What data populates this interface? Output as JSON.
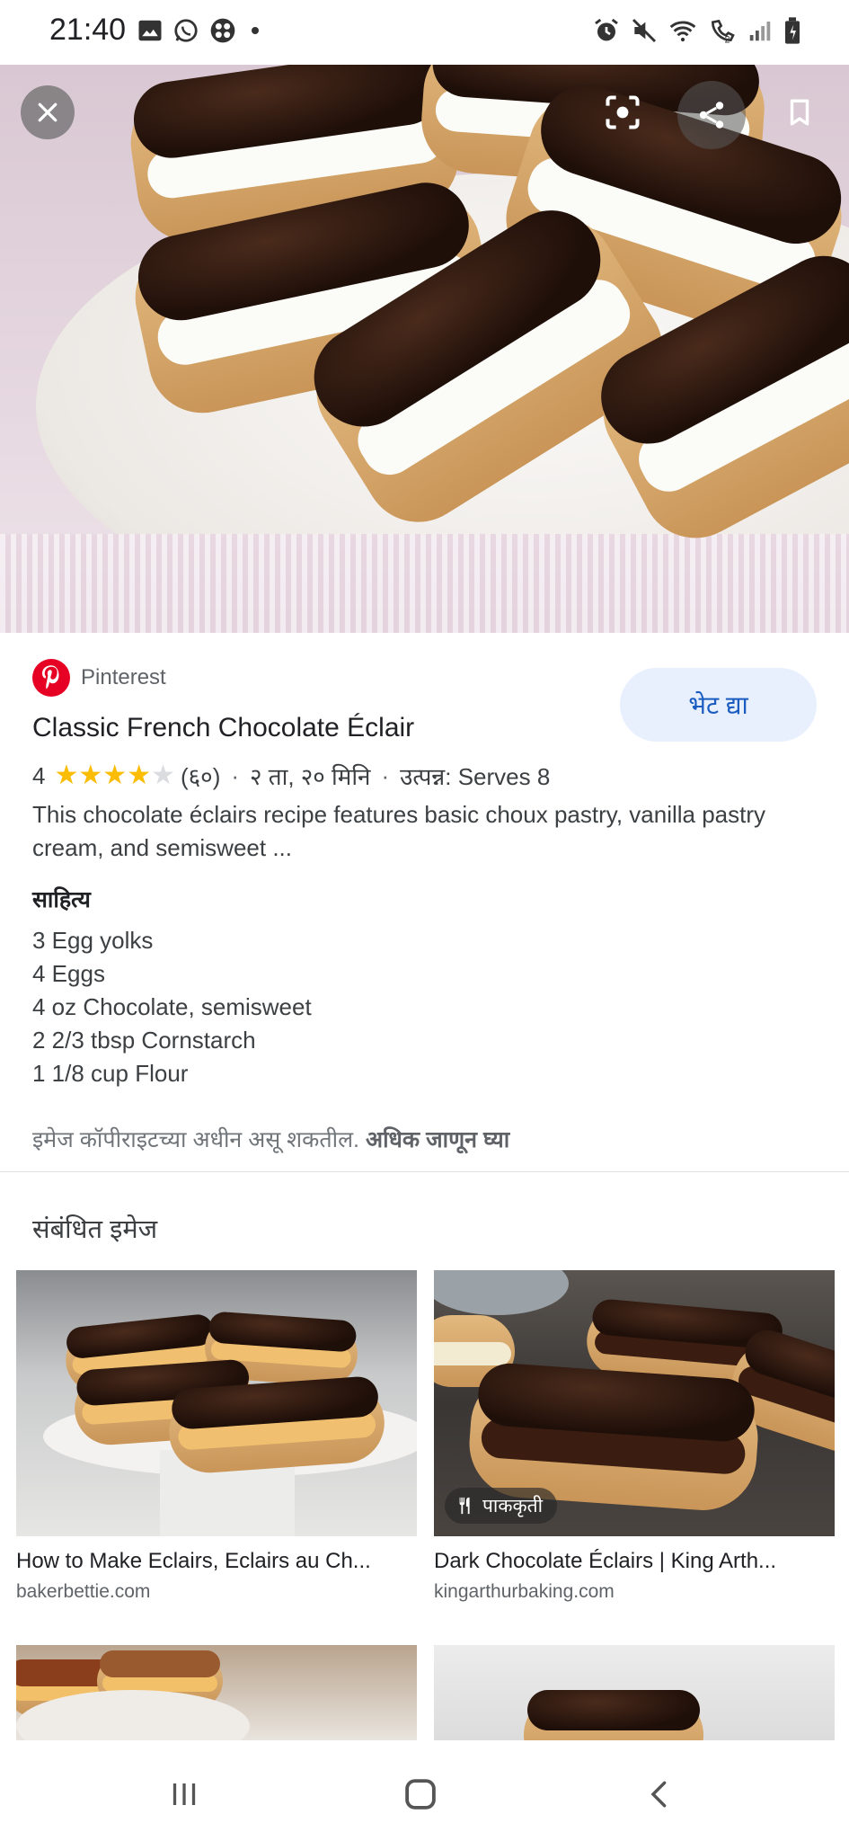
{
  "status_bar": {
    "time": "21:40"
  },
  "hero": {
    "colors": {
      "chocolate": "#2a150c",
      "pastry": "#d9a868",
      "cream": "#fbfbf7"
    }
  },
  "source": {
    "name": "Pinterest",
    "brand_color": "#e60023"
  },
  "visit_button": {
    "label": "भेट द्या"
  },
  "recipe": {
    "title": "Classic French Chocolate Éclair",
    "rating_value": "4",
    "rating_stars": 4,
    "rating_count": "(६०)",
    "time": "२ ता, २० मिनि",
    "yield": "उत्पन्न: Serves 8",
    "description": "This chocolate éclairs recipe features basic choux pastry, vanilla pastry cream, and semisweet ...",
    "ingredients_heading": "साहित्य",
    "ingredients": [
      "3 Egg yolks",
      "4 Eggs",
      "4 oz Chocolate, semisweet",
      "2 2/3 tbsp Cornstarch",
      "1 1/8 cup Flour"
    ]
  },
  "copyright": {
    "text": "इमेज कॉपीराइटच्या अधीन असू शकतील.",
    "link": "अधिक जाणून घ्या"
  },
  "related": {
    "heading": "संबंधित इमेज",
    "items": [
      {
        "title": "How to Make Eclairs, Eclairs au Ch...",
        "domain": "bakerbettie.com"
      },
      {
        "title": "Dark Chocolate Éclairs | King Arth...",
        "domain": "kingarthurbaking.com",
        "badge": "पाककृती"
      }
    ]
  },
  "icons": [
    "close-icon",
    "lens-icon",
    "share-icon",
    "bookmark-icon",
    "pinterest-logo",
    "star-icon",
    "utensils-icon",
    "recents-icon",
    "home-icon",
    "back-icon"
  ],
  "accent_color": "#1a5cbf",
  "star_color": "#fbbc04"
}
